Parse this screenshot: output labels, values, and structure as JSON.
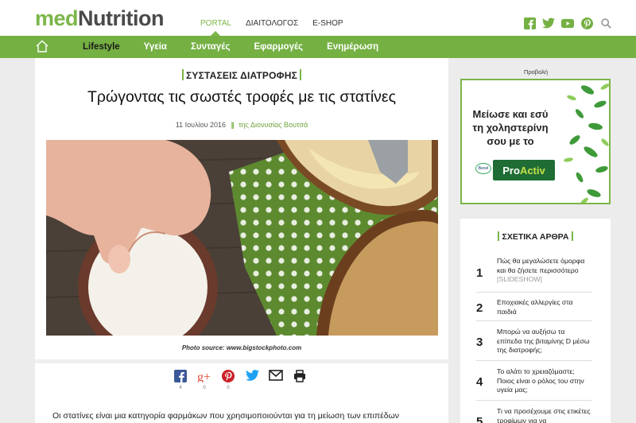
{
  "brand": {
    "logo_part1": "med",
    "logo_part2": "Nutrition",
    "accent": "#7ab648"
  },
  "topnav": [
    {
      "label": "PORTAL",
      "active": true
    },
    {
      "label": "ΔΙΑΙΤΟΛΟΓΟΣ",
      "active": false
    },
    {
      "label": "E-SHOP",
      "active": false
    }
  ],
  "social_top": [
    "facebook-icon",
    "twitter-icon",
    "youtube-icon",
    "pinterest-icon",
    "search-icon"
  ],
  "mainnav": [
    {
      "label": "Lifestyle",
      "active": true
    },
    {
      "label": "Υγεία",
      "active": false
    },
    {
      "label": "Συνταγές",
      "active": false
    },
    {
      "label": "Εφαρμογές",
      "active": false
    },
    {
      "label": "Ενημέρωση",
      "active": false
    }
  ],
  "article": {
    "category": "ΣΥΣΤΑΣΕΙΣ ΔΙΑΤΡΟΦΗΣ",
    "title": "Τρώγοντας τις σωστές τροφές με τις στατίνες",
    "date": "11 Ιουλίου 2016",
    "separator": "||",
    "author": "της Διονυσίας Βουτσά",
    "caption": "Photo source: www.bigstockphoto.com",
    "share": [
      {
        "icon": "facebook-icon",
        "count": "4"
      },
      {
        "icon": "google-plus-icon",
        "count": "0"
      },
      {
        "icon": "pinterest-icon",
        "count": "0"
      },
      {
        "icon": "twitter-icon",
        "count": ""
      },
      {
        "icon": "email-icon",
        "count": ""
      },
      {
        "icon": "print-icon",
        "count": ""
      }
    ],
    "body_first_line": "Οι στατίνες είναι μια κατηγορία φαρμάκων που χρησιμοποιούνται για τη μείωση των επιπέδων"
  },
  "sidebar": {
    "ad_label": "Προβολή",
    "ad_line1": "Μείωσε και εσύ",
    "ad_line2": "τη χοληστερίνη",
    "ad_line3": "σου με το",
    "ad_brand_pro": "Pro",
    "ad_brand_activ": "Activ",
    "ad_becel": "Becel",
    "related_title": "ΣΧΕΤΙΚΑ ΑΡΘΡΑ",
    "related": [
      {
        "num": "1",
        "text": "Πώς θα μεγαλώσετε όμορφα και θα ζήσετε περισσότερο",
        "tag": "[SLIDESHOW]"
      },
      {
        "num": "2",
        "text": "Εποχιακές αλλεργίες στα παιδιά",
        "tag": ""
      },
      {
        "num": "3",
        "text": "Μπορώ να αυξήσω τα επίπεδα της βιταμίνης D μέσω της διατροφής;",
        "tag": ""
      },
      {
        "num": "4",
        "text": "Το αλάτι το χρειαζόμαστε; Ποιος είναι ο ρόλος του στην υγεία μας;",
        "tag": ""
      },
      {
        "num": "5",
        "text": "Τι να προσέχουμε στις ετικέτες τροφίμων για να",
        "tag": ""
      }
    ]
  }
}
